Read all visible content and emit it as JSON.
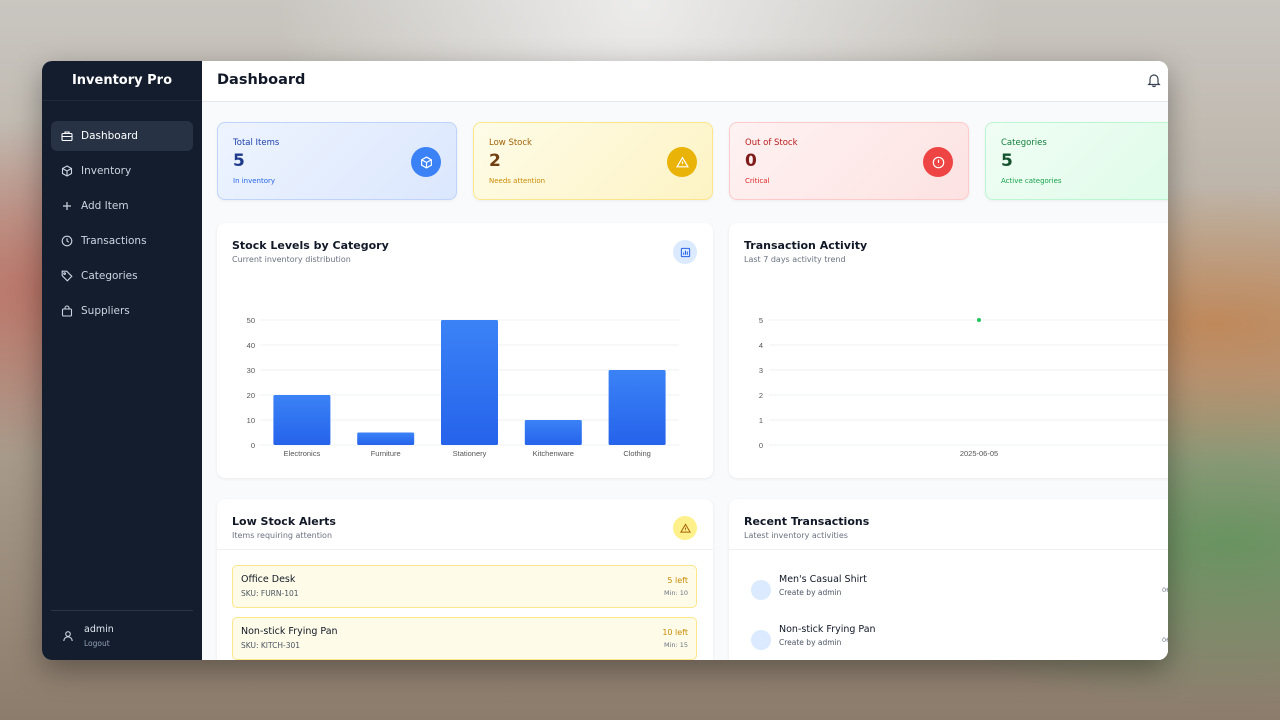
{
  "app": {
    "brand": "Inventory Pro"
  },
  "sidebar": {
    "items": [
      {
        "label": "Dashboard",
        "icon": "briefcase-icon",
        "active": true
      },
      {
        "label": "Inventory",
        "icon": "box-icon"
      },
      {
        "label": "Add Item",
        "icon": "plus-icon"
      },
      {
        "label": "Transactions",
        "icon": "clock-icon"
      },
      {
        "label": "Categories",
        "icon": "tag-icon"
      },
      {
        "label": "Suppliers",
        "icon": "shopping-bag-icon"
      }
    ],
    "user": {
      "name": "admin",
      "logout": "Logout"
    }
  },
  "header": {
    "title": "Dashboard"
  },
  "stats": [
    {
      "label": "Total Items",
      "value": "5",
      "sub": "In inventory",
      "color": "#2563eb",
      "icon": "box-icon"
    },
    {
      "label": "Low Stock",
      "value": "2",
      "sub": "Needs attention",
      "color": "#ca8a04",
      "icon": "warning-icon"
    },
    {
      "label": "Out of Stock",
      "value": "0",
      "sub": "Critical",
      "color": "#dc2626",
      "icon": "alert-circle-icon"
    },
    {
      "label": "Categories",
      "value": "5",
      "sub": "Active categories",
      "color": "#16a34a",
      "icon": "tag-icon"
    }
  ],
  "stock_chart": {
    "title": "Stock Levels by Category",
    "subtitle": "Current inventory distribution"
  },
  "activity_chart": {
    "title": "Transaction Activity",
    "subtitle": "Last 7 days activity trend"
  },
  "chart_data": [
    {
      "type": "bar",
      "categories": [
        "Electronics",
        "Furniture",
        "Stationery",
        "Kitchenware",
        "Clothing"
      ],
      "values": [
        20,
        5,
        50,
        10,
        30
      ],
      "yticks": [
        0,
        10,
        20,
        30,
        40,
        50
      ],
      "ylim": [
        0,
        50
      ],
      "color": "#2563eb",
      "grid": true
    },
    {
      "type": "scatter",
      "x": [
        "2025-06-05"
      ],
      "values": [
        5
      ],
      "yticks": [
        0,
        1,
        2,
        3,
        4,
        5
      ],
      "ylim": [
        0,
        5
      ],
      "color": "#22c55e",
      "grid": true
    }
  ],
  "low_stock": {
    "title": "Low Stock Alerts",
    "subtitle": "Items requiring attention",
    "items": [
      {
        "name": "Office Desk",
        "sku": "SKU: FURN-101",
        "left": "5 left",
        "min": "Min: 10"
      },
      {
        "name": "Non-stick Frying Pan",
        "sku": "SKU: KITCH-301",
        "left": "10 left",
        "min": "Min: 15"
      }
    ]
  },
  "recent": {
    "title": "Recent Transactions",
    "subtitle": "Latest inventory activities",
    "items": [
      {
        "name": "Men's Casual Shirt",
        "by": "Create by admin",
        "date": "06"
      },
      {
        "name": "Non-stick Frying Pan",
        "by": "Create by admin",
        "date": "06"
      }
    ]
  }
}
